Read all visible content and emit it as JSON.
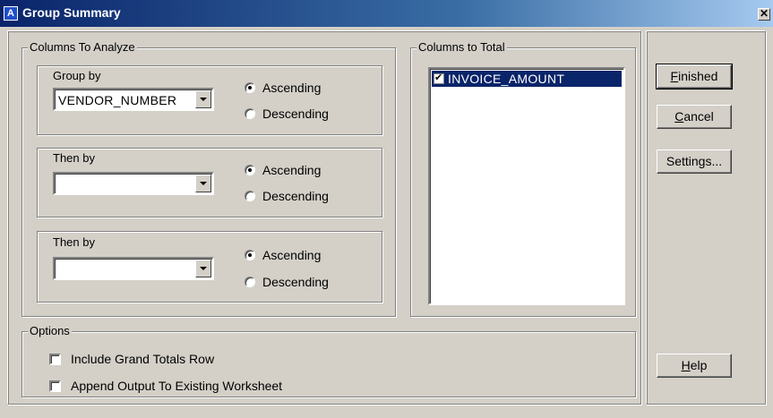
{
  "window": {
    "title": "Group Summary",
    "close_glyph": "✕",
    "app_icon": "app-icon"
  },
  "columns_to_analyze": {
    "legend": "Columns To Analyze",
    "groups": [
      {
        "label": "Group by",
        "value": "VENDOR_NUMBER",
        "ascending": "Ascending",
        "descending": "Descending",
        "selected": "Ascending"
      },
      {
        "label": "Then by",
        "value": "",
        "ascending": "Ascending",
        "descending": "Descending",
        "selected": "Ascending"
      },
      {
        "label": "Then by",
        "value": "",
        "ascending": "Ascending",
        "descending": "Descending",
        "selected": "Ascending"
      }
    ]
  },
  "columns_to_total": {
    "legend": "Columns to Total",
    "items": [
      {
        "label": "INVOICE_AMOUNT",
        "checked": true,
        "selected": true
      }
    ]
  },
  "options": {
    "legend": "Options",
    "include_grand_totals": {
      "label": "Include Grand Totals Row",
      "checked": false
    },
    "append_output": {
      "label": "Append Output To Existing Worksheet",
      "checked": false
    }
  },
  "buttons": {
    "finished": {
      "first": "F",
      "rest": "inished"
    },
    "cancel": {
      "first": "C",
      "rest": "ancel"
    },
    "settings": "Settings...",
    "help": {
      "first": "H",
      "rest": "elp"
    }
  }
}
